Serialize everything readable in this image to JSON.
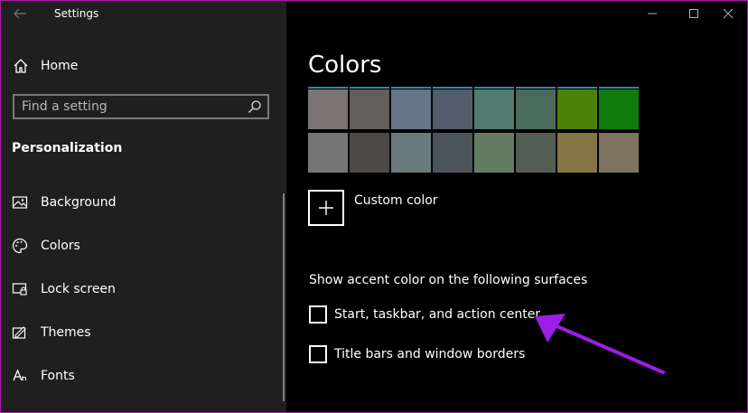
{
  "titlebar": {
    "title": "Settings",
    "back_icon": "back-arrow-icon"
  },
  "window_controls": [
    "minimize-icon",
    "maximize-icon",
    "close-icon"
  ],
  "sidebar": {
    "home_label": "Home",
    "search": {
      "placeholder": "Find a setting",
      "value": ""
    },
    "section_title": "Personalization",
    "items": [
      {
        "label": "Background",
        "icon": "background-image-icon"
      },
      {
        "label": "Colors",
        "icon": "palette-icon"
      },
      {
        "label": "Lock screen",
        "icon": "lock-screen-icon"
      },
      {
        "label": "Themes",
        "icon": "themes-icon"
      },
      {
        "label": "Fonts",
        "icon": "fonts-icon"
      }
    ]
  },
  "main": {
    "title": "Colors",
    "swatches_row1": [
      "#7a7474",
      "#625e59",
      "#67758a",
      "#525c6b",
      "#527a6f",
      "#4a6a5c",
      "#498205",
      "#107c10"
    ],
    "swatches_row2": [
      "#757575",
      "#4c4a48",
      "#69797e",
      "#4a5459",
      "#647c64",
      "#525e54",
      "#847545",
      "#7e735f"
    ],
    "custom_color_label": "Custom color",
    "surfaces_heading": "Show accent color on the following surfaces",
    "checkboxes": [
      {
        "label": "Start, taskbar, and action center",
        "checked": false
      },
      {
        "label": "Title bars and window borders",
        "checked": false
      }
    ]
  },
  "colors": {
    "sidebar_bg": "#1f1f1f",
    "main_bg": "#000000",
    "annotation_arrow": "#9b1de6",
    "swatch_top_accent": "#2f8ca6"
  }
}
